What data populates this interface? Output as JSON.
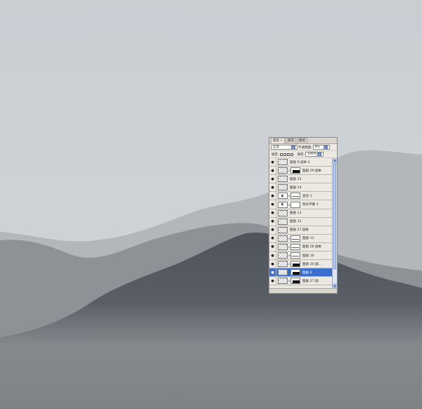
{
  "colors": {
    "sky": "#cfd3d7",
    "far_ridge": "#b1b5ba",
    "mid_ridge": "#8c9095",
    "near_ridge": "#555a62",
    "valley": "#868a8e",
    "selection": "#3a6fce"
  },
  "panel": {
    "tabs": [
      {
        "label": "图层",
        "close": "×"
      },
      {
        "label": "通道"
      },
      {
        "label": "路径"
      }
    ],
    "blend_mode": "正常",
    "opacity_label": "不透明度:",
    "opacity_value": "9%",
    "lock_label": "锁定:",
    "fill_label": "填充:",
    "fill_value": "100%",
    "layers": [
      {
        "name": "图层 9 副本 3",
        "type": "pixel",
        "visible": true
      },
      {
        "name": "图层 29 副本",
        "type": "pixel-mask",
        "mask": "black",
        "visible": true
      },
      {
        "name": "图层 15",
        "type": "pixel",
        "visible": true
      },
      {
        "name": "图层 14",
        "type": "pixel",
        "visible": true
      },
      {
        "name": "混合 1",
        "type": "adjust-mask",
        "mask": "line",
        "visible": true
      },
      {
        "name": "色彩平衡 1",
        "type": "adjust-mask",
        "mask": "white",
        "visible": true
      },
      {
        "name": "图层 13",
        "type": "pixel",
        "visible": true
      },
      {
        "name": "图层 12",
        "type": "pixel",
        "visible": true
      },
      {
        "name": "图层 27 副本",
        "type": "pixel",
        "visible": true
      },
      {
        "name": "图层 11",
        "type": "pixel-mask",
        "mask": "line",
        "visible": true
      },
      {
        "name": "图层 28 副本",
        "type": "pixel-mask",
        "mask": "line",
        "visible": true
      },
      {
        "name": "图层 10",
        "type": "pixel-mask",
        "mask": "line",
        "visible": true
      },
      {
        "name": "图层 30 副...",
        "type": "pixel-mask",
        "mask": "black",
        "visible": true
      },
      {
        "name": "图层 6",
        "type": "pixel-mask",
        "mask": "black",
        "visible": true,
        "selected": true
      },
      {
        "name": "图层 27 副...",
        "type": "pixel-mask",
        "mask": "black",
        "visible": true
      }
    ]
  }
}
